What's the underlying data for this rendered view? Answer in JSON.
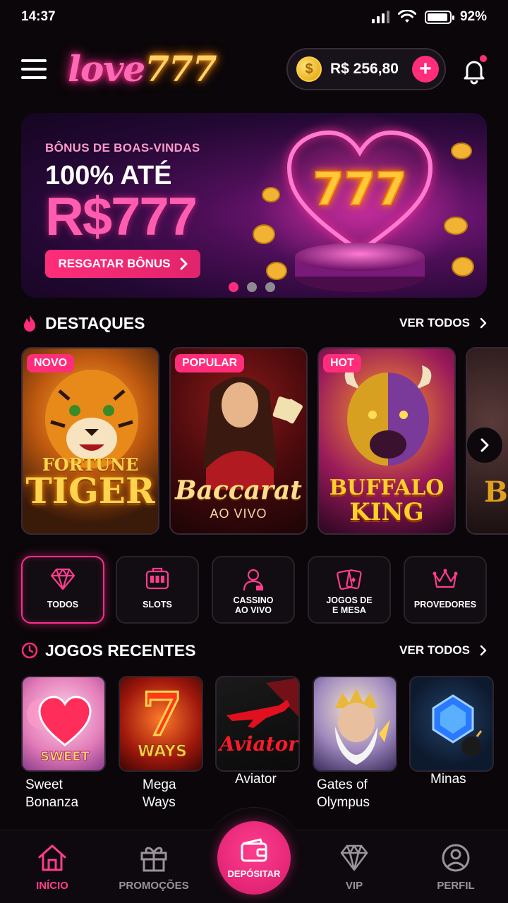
{
  "status_bar": {
    "time": "14:37",
    "battery": "92%",
    "battery_level": 0.92
  },
  "header": {
    "logo_love": "love",
    "logo_num": "777",
    "balance": "R$ 256,80",
    "add_symbol": "+"
  },
  "banner": {
    "kicker": "BÔNUS DE BOAS-VINDAS",
    "line1": "100% ATÉ",
    "line2": "R$777",
    "cta": "RESGATAR BÔNUS",
    "art_text": "777",
    "slides": 3,
    "active_slide": 1
  },
  "featured": {
    "title": "DESTAQUES",
    "see_all": "VER TODOS",
    "cards": [
      {
        "badge": "NOVO",
        "title_top": "FORTUNE",
        "title_main": "TIGER"
      },
      {
        "badge": "POPULAR",
        "title_top": "Baccarat",
        "title_main": "AO VIVO"
      },
      {
        "badge": "HOT",
        "title_top": "BUFFALO",
        "title_main": "KING"
      },
      {
        "title_partial": "B"
      }
    ]
  },
  "categories": [
    {
      "label": "TODOS",
      "icon": "diamond-icon",
      "active": true
    },
    {
      "label": "SLOTS",
      "icon": "slot-machine-icon"
    },
    {
      "label": "CASSINO\nAO VIVO",
      "icon": "live-dealer-icon"
    },
    {
      "label": "JOGOS DE\nE MESA",
      "icon": "cards-icon"
    },
    {
      "label": "PROVEDORES",
      "icon": "crown-icon"
    }
  ],
  "recent": {
    "title": "JOGOS RECENTES",
    "see_all": "VER TODOS",
    "games": [
      {
        "name": "Sweet\nBonanza",
        "thumb_text": "SWEET"
      },
      {
        "name": "Mega\nWays",
        "thumb_text": "WAYS"
      },
      {
        "name": "Aviator",
        "thumb_text": "Aviator"
      },
      {
        "name": "Gates of\nOlympus"
      },
      {
        "name": "Minas"
      }
    ]
  },
  "bottom_nav": {
    "home": "INÍCIO",
    "promos": "PROMOÇÕES",
    "deposit": "DEPÓSITAR",
    "vip": "VIP",
    "profile": "PERFIL"
  },
  "colors": {
    "accent": "#ff2d7a",
    "background": "#0a0609",
    "gold": "#ffcf3f"
  }
}
